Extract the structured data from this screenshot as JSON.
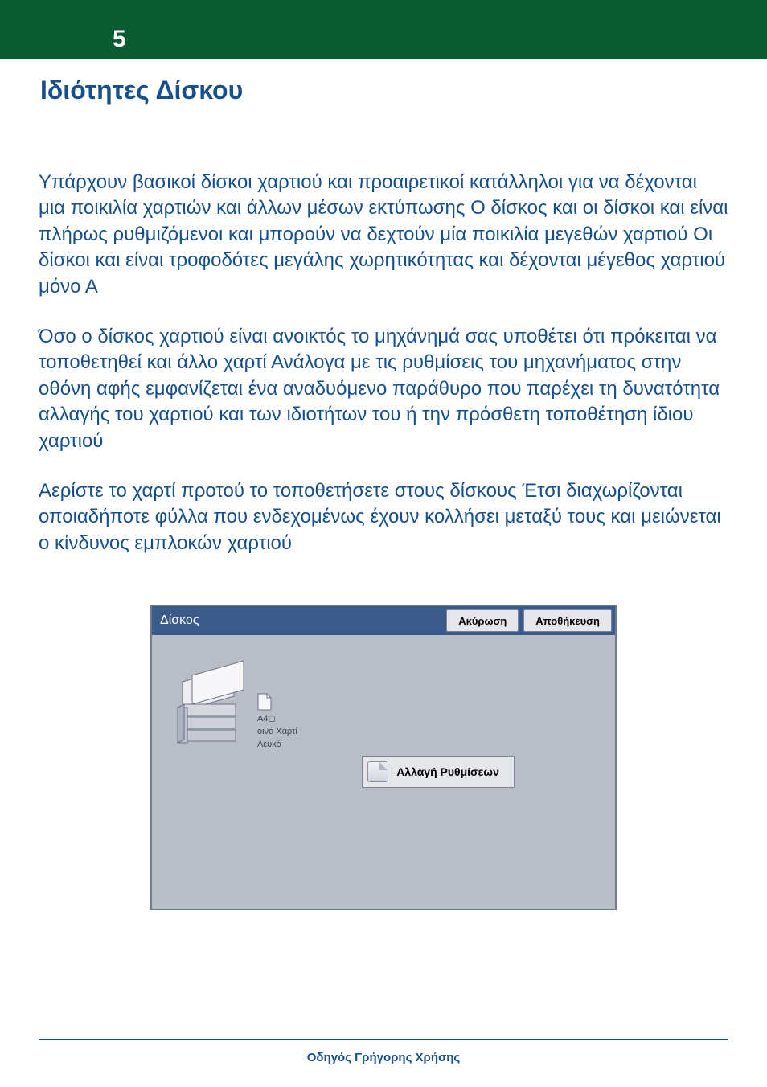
{
  "header": {
    "page_number": "5",
    "title": "Ιδιότητες Δίσκου"
  },
  "paragraphs": {
    "p1": "Υπάρχουν    βασικοί δίσκοι χαρτιού και    προαιρετικοί  κατάλληλοι για να δέχονται μια ποικιλία χαρτιών και άλλων μέσων εκτύπωσης  Ο δίσκος              και οι δίσκοι    και    είναι πλήρως ρυθμιζόμενοι και μπορούν να δεχτούν μία ποικιλία μεγεθών χαρτιού   Οι δίσκοι    και    είναι τροφοδότες μεγάλης χωρητικότητας και δέχονται μέγεθος χαρτιού μόνο Α",
    "p2": "Όσο ο δίσκος χαρτιού είναι ανοικτός  το μηχάνημά σας υποθέτει ότι πρόκειται να τοποθετηθεί και άλλο χαρτί   Ανάλογα με τις ρυθμίσεις του μηχανήματος  στην οθόνη αφής εμφανίζεται ένα αναδυόμενο παράθυρο που παρέχει τη δυνατότητα αλλαγής του χαρτιού και των ιδιοτήτων του ή την πρόσθετη τοποθέτηση ίδιου χαρτιού",
    "p3": "Αερίστε το χαρτί προτού το τοποθετήσετε στους δίσκους  Έτσι διαχωρίζονται οποιαδήποτε φύλλα που ενδεχομένως έχουν κολλήσει μεταξύ τους και μειώνεται ο κίνδυνος εμπλοκών χαρτιού"
  },
  "dialog": {
    "title": "Δίσκος",
    "cancel": "Ακύρωση",
    "save": "Αποθήκευση",
    "tray_info": {
      "size": "A4◻",
      "type": "οινό Χαρτί",
      "color": "Λευκό"
    },
    "change_settings": "Αλλαγή Ρυθμίσεων"
  },
  "footer": "Οδηγός Γρήγορης Χρήσης"
}
